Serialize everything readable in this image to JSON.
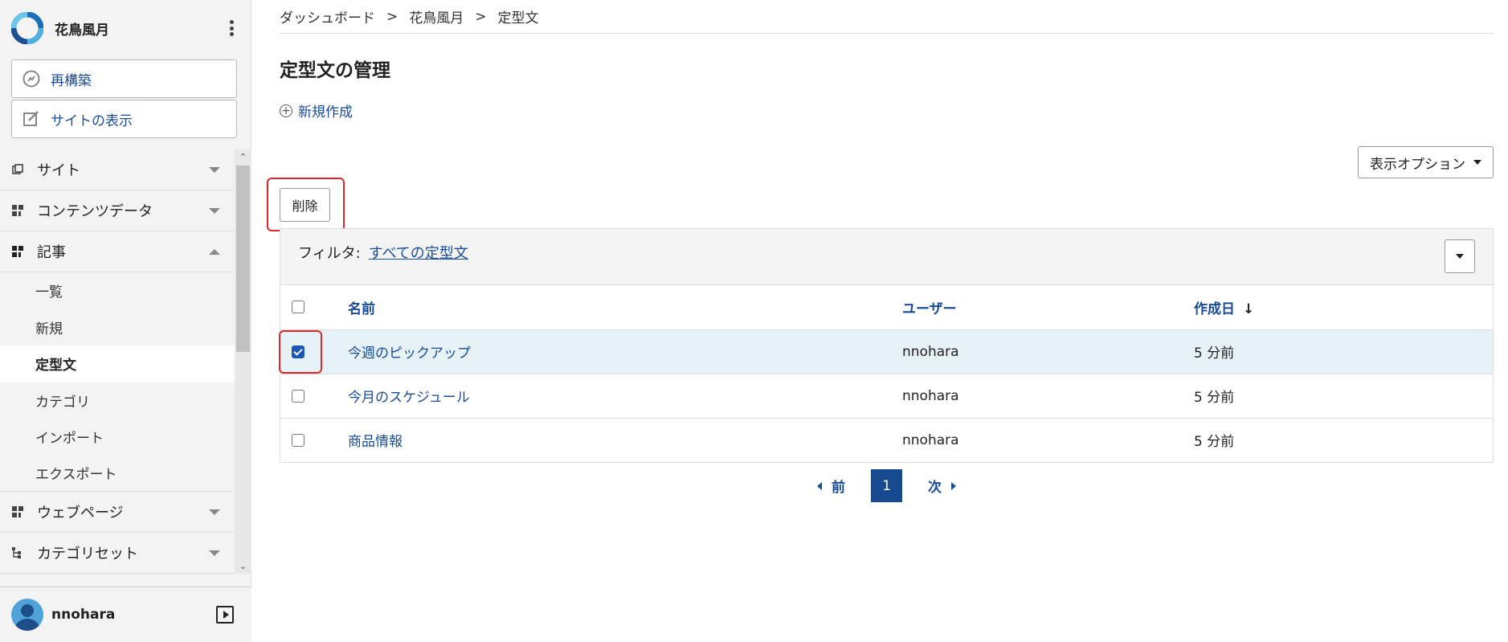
{
  "sidebar": {
    "site_name": "花鳥風月",
    "rebuild_label": "再構築",
    "view_site_label": "サイトの表示",
    "nav": [
      {
        "label": "サイト"
      },
      {
        "label": "コンテンツデータ"
      },
      {
        "label": "記事"
      },
      {
        "label": "ウェブページ"
      },
      {
        "label": "カテゴリセット"
      }
    ],
    "sub_items": [
      {
        "label": "一覧"
      },
      {
        "label": "新規"
      },
      {
        "label": "定型文"
      },
      {
        "label": "カテゴリ"
      },
      {
        "label": "インポート"
      },
      {
        "label": "エクスポート"
      }
    ],
    "user": "nnohara"
  },
  "breadcrumb": [
    "ダッシュボード",
    "花鳥風月",
    "定型文"
  ],
  "breadcrumb_sep": ">",
  "page_title": "定型文の管理",
  "new_label": "新規作成",
  "view_options_label": "表示オプション",
  "delete_label": "削除",
  "filter": {
    "label": "フィルタ:",
    "value": "すべての定型文"
  },
  "table": {
    "headers": {
      "name": "名前",
      "user": "ユーザー",
      "created": "作成日"
    },
    "sort_arrow": "↓",
    "rows": [
      {
        "name": "今週のピックアップ",
        "user": "nnohara",
        "created": "5 分前",
        "checked": true
      },
      {
        "name": "今月のスケジュール",
        "user": "nnohara",
        "created": "5 分前",
        "checked": false
      },
      {
        "name": "商品情報",
        "user": "nnohara",
        "created": "5 分前",
        "checked": false
      }
    ]
  },
  "pager": {
    "prev": "前",
    "page": "1",
    "next": "次"
  },
  "colors": {
    "accent": "#1a4c95",
    "highlight": "#e0262a",
    "selected_row": "#e6f2f6"
  }
}
